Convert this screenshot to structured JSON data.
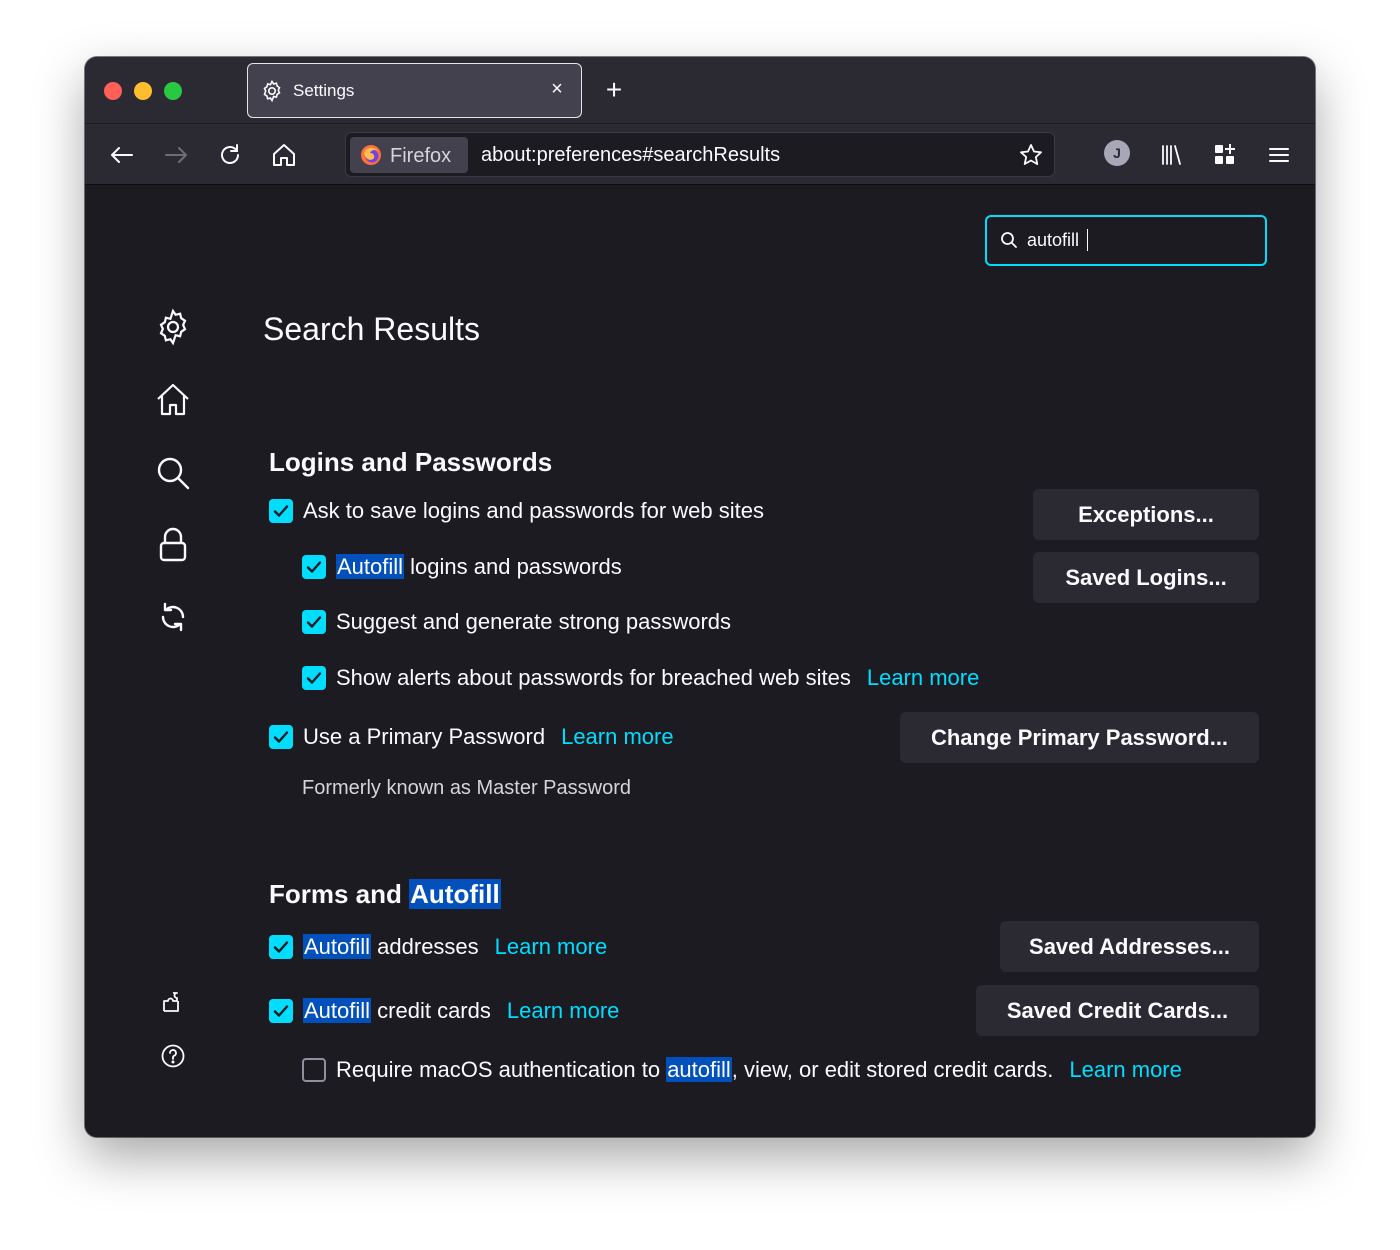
{
  "tab": {
    "title": "Settings",
    "close": "×"
  },
  "newtab": "+",
  "urlbar": {
    "identity_label": "Firefox",
    "url": "about:preferences#searchResults"
  },
  "account_initial": "J",
  "search": {
    "value": "autofill"
  },
  "page_title": "Search Results",
  "logins": {
    "title": "Logins and Passwords",
    "ask_save": "Ask to save logins and passwords for web sites",
    "autofill_hl": "Autofill",
    "autofill_rest": " logins and passwords",
    "suggest": "Suggest and generate strong passwords",
    "alerts": "Show alerts about passwords for breached web sites",
    "alerts_link": "Learn more",
    "primary": "Use a Primary Password",
    "primary_link": "Learn more",
    "formerly": "Formerly known as Master Password",
    "exceptions_btn": "Exceptions...",
    "saved_logins_btn": "Saved Logins...",
    "change_primary_btn": "Change Primary Password..."
  },
  "forms": {
    "title_plain": "Forms and ",
    "title_hl": "Autofill",
    "addresses_hl": "Autofill",
    "addresses_rest": " addresses",
    "addresses_link": "Learn more",
    "cards_hl": "Autofill",
    "cards_rest": " credit cards",
    "cards_link": "Learn more",
    "require_pre": "Require macOS authentication to ",
    "require_hl": "autofill",
    "require_post": ", view, or edit stored credit cards.",
    "require_link": "Learn more",
    "saved_addresses_btn": "Saved Addresses...",
    "saved_cards_btn": "Saved Credit Cards..."
  },
  "colors": {
    "accent": "#00ddff",
    "highlight": "#0250bb",
    "background": "#1c1b22",
    "toolbar": "#2b2a33"
  }
}
